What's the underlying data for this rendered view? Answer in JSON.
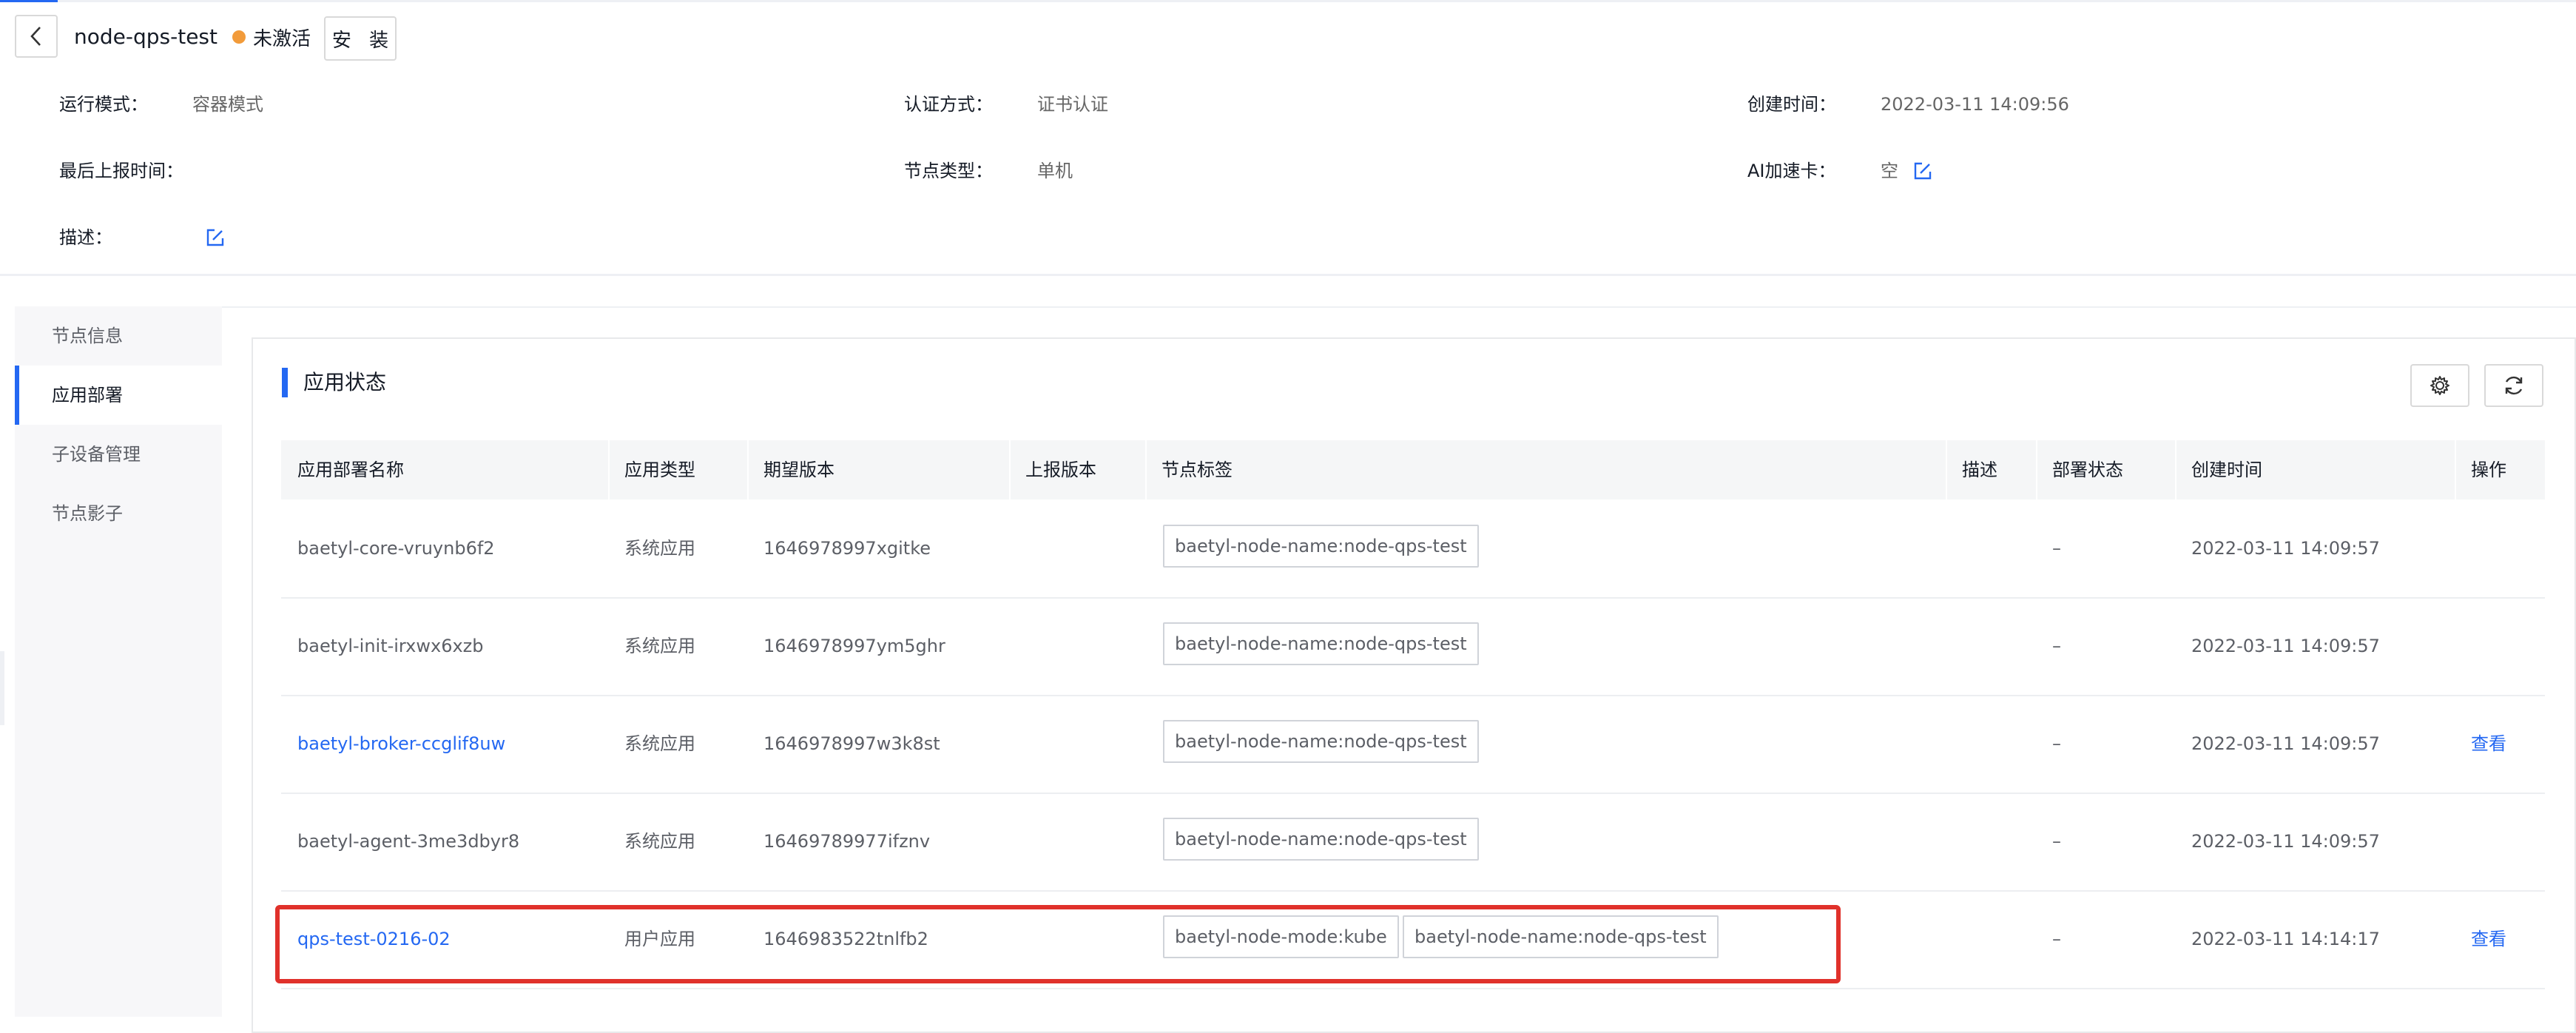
{
  "header": {
    "node_name": "node-qps-test",
    "status": "未激活",
    "install_label": "安 装"
  },
  "info": {
    "run_mode_label": "运行模式：",
    "run_mode_value": "容器模式",
    "auth_label": "认证方式：",
    "auth_value": "证书认证",
    "created_label": "创建时间：",
    "created_value": "2022-03-11 14:09:56",
    "last_report_label": "最后上报时间：",
    "last_report_value": "",
    "node_type_label": "节点类型：",
    "node_type_value": "单机",
    "ai_label": "AI加速卡：",
    "ai_value": "空",
    "desc_label": "描述："
  },
  "sidebar": {
    "items": [
      {
        "label": "节点信息"
      },
      {
        "label": "应用部署"
      },
      {
        "label": "子设备管理"
      },
      {
        "label": "节点影子"
      }
    ]
  },
  "panel": {
    "title": "应用状态"
  },
  "table": {
    "headers": [
      "应用部署名称",
      "应用类型",
      "期望版本",
      "上报版本",
      "节点标签",
      "描述",
      "部署状态",
      "创建时间",
      "操作"
    ],
    "rows": [
      {
        "name": "baetyl-core-vruynb6f2",
        "type": "系统应用",
        "version": "1646978997xgitke",
        "tags": [
          "baetyl-node-name:node-qps-test"
        ],
        "status": "–",
        "created": "2022-03-11 14:09:57",
        "action": ""
      },
      {
        "name": "baetyl-init-irxwx6xzb",
        "type": "系统应用",
        "version": "1646978997ym5ghr",
        "tags": [
          "baetyl-node-name:node-qps-test"
        ],
        "status": "–",
        "created": "2022-03-11 14:09:57",
        "action": ""
      },
      {
        "name": "baetyl-broker-ccglif8uw",
        "type": "系统应用",
        "version": "1646978997w3k8st",
        "tags": [
          "baetyl-node-name:node-qps-test"
        ],
        "status": "–",
        "created": "2022-03-11 14:09:57",
        "action": "查看"
      },
      {
        "name": "baetyl-agent-3me3dbyr8",
        "type": "系统应用",
        "version": "16469789977ifznv",
        "tags": [
          "baetyl-node-name:node-qps-test"
        ],
        "status": "–",
        "created": "2022-03-11 14:09:57",
        "action": ""
      },
      {
        "name": "qps-test-0216-02",
        "type": "用户应用",
        "version": "1646983522tnlfb2",
        "tags": [
          "baetyl-node-mode:kube",
          "baetyl-node-name:node-qps-test"
        ],
        "status": "–",
        "created": "2022-03-11 14:14:17",
        "action": "查看"
      }
    ]
  },
  "colors": {
    "accent": "#2468f2",
    "status_dot": "#f29b3a",
    "highlight": "#e0312b"
  }
}
